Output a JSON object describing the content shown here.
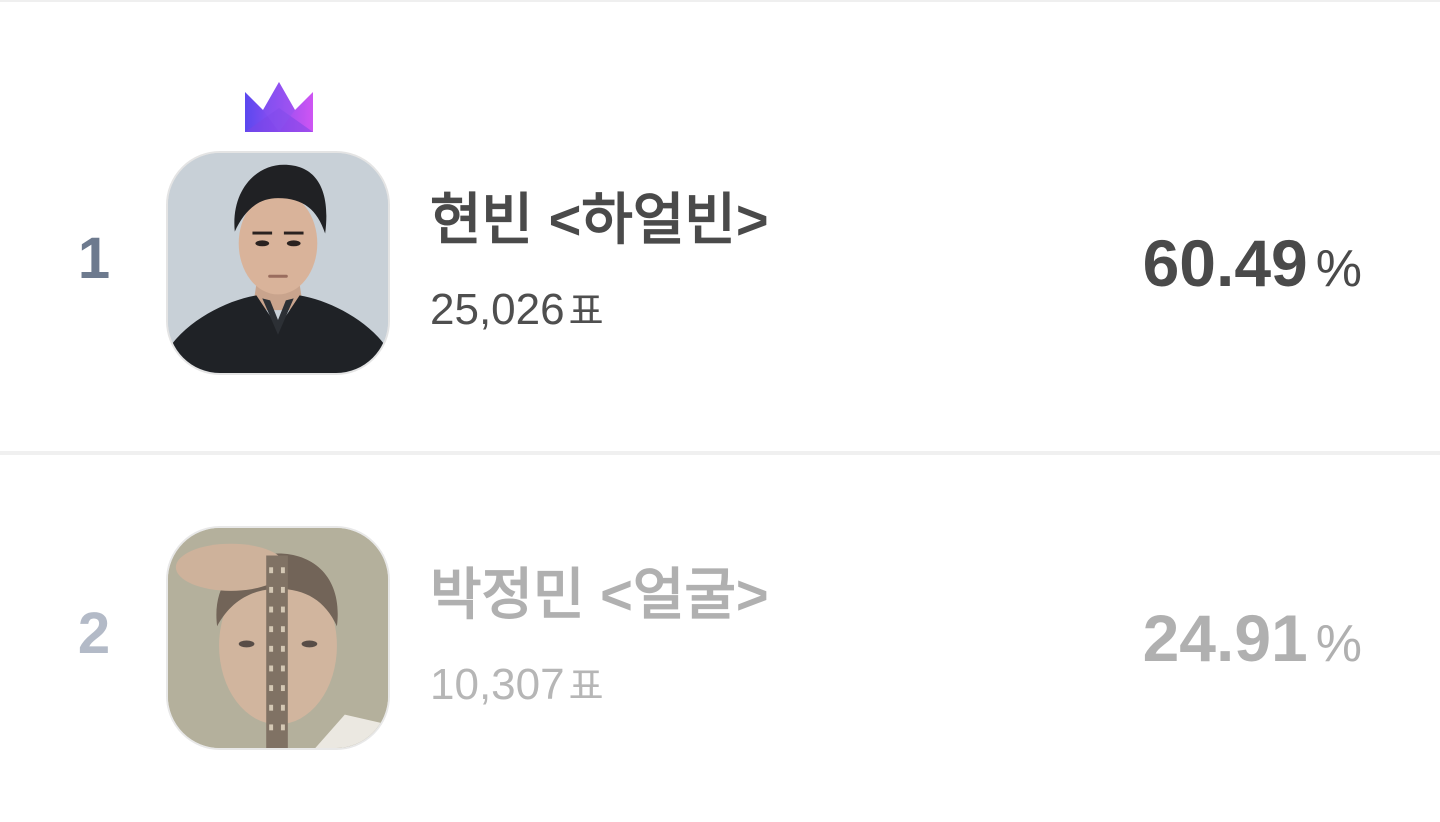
{
  "ranking": [
    {
      "rank": "1",
      "name": "현빈 <하얼빈>",
      "votes": "25,026",
      "vote_unit": "표",
      "percent": "60.49",
      "percent_sign": "%",
      "avatar_icon": "actor-photo-hyunbin",
      "badge_icon": "crown-icon"
    },
    {
      "rank": "2",
      "name": "박정민 <얼굴>",
      "votes": "10,307",
      "vote_unit": "표",
      "percent": "24.91",
      "percent_sign": "%",
      "avatar_icon": "actor-photo-parkjungmin"
    }
  ],
  "colors": {
    "crown_left": "#5b4af0",
    "crown_right": "#c84ef0",
    "first_text": "#4a4a4a",
    "second_text": "#b0b0b0"
  }
}
